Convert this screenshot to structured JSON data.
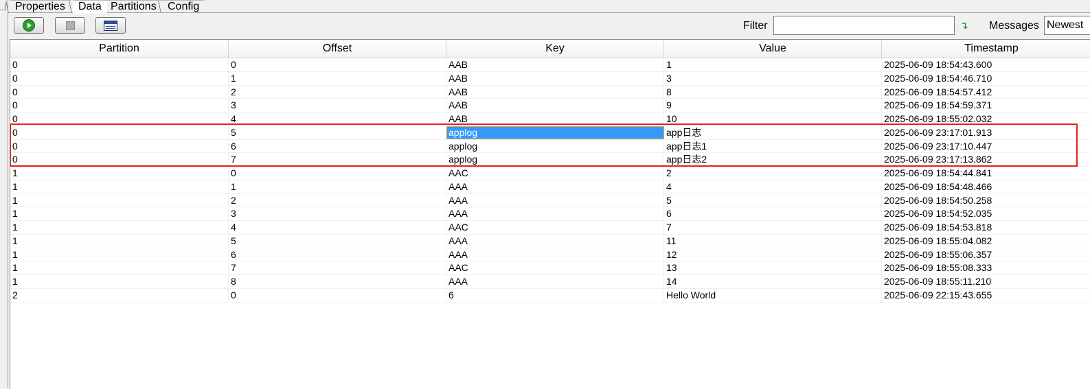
{
  "tabs": [
    {
      "label": "Properties"
    },
    {
      "label": "Data"
    },
    {
      "label": "Partitions"
    },
    {
      "label": "Config"
    }
  ],
  "toolbar": {
    "filter_label": "Filter",
    "filter_value": "",
    "messages_label": "Messages",
    "messages_selected": "Newest"
  },
  "table": {
    "columns": [
      "Partition",
      "Offset",
      "Key",
      "Value",
      "Timestamp"
    ],
    "rows": [
      [
        "0",
        "0",
        "AAB",
        "1",
        "2025-06-09 18:54:43.600"
      ],
      [
        "0",
        "1",
        "AAB",
        "3",
        "2025-06-09 18:54:46.710"
      ],
      [
        "0",
        "2",
        "AAB",
        "8",
        "2025-06-09 18:54:57.412"
      ],
      [
        "0",
        "3",
        "AAB",
        "9",
        "2025-06-09 18:54:59.371"
      ],
      [
        "0",
        "4",
        "AAB",
        "10",
        "2025-06-09 18:55:02.032"
      ],
      [
        "0",
        "5",
        "applog",
        "app日志",
        "2025-06-09 23:17:01.913"
      ],
      [
        "0",
        "6",
        "applog",
        "app日志1",
        "2025-06-09 23:17:10.447"
      ],
      [
        "0",
        "7",
        "applog",
        "app日志2",
        "2025-06-09 23:17:13.862"
      ],
      [
        "1",
        "0",
        "AAC",
        "2",
        "2025-06-09 18:54:44.841"
      ],
      [
        "1",
        "1",
        "AAA",
        "4",
        "2025-06-09 18:54:48.466"
      ],
      [
        "1",
        "2",
        "AAA",
        "5",
        "2025-06-09 18:54:50.258"
      ],
      [
        "1",
        "3",
        "AAA",
        "6",
        "2025-06-09 18:54:52.035"
      ],
      [
        "1",
        "4",
        "AAC",
        "7",
        "2025-06-09 18:54:53.818"
      ],
      [
        "1",
        "5",
        "AAA",
        "11",
        "2025-06-09 18:55:04.082"
      ],
      [
        "1",
        "6",
        "AAA",
        "12",
        "2025-06-09 18:55:06.357"
      ],
      [
        "1",
        "7",
        "AAC",
        "13",
        "2025-06-09 18:55:08.333"
      ],
      [
        "1",
        "8",
        "AAA",
        "14",
        "2025-06-09 18:55:11.210"
      ],
      [
        "2",
        "0",
        "6",
        "Hello World",
        "2025-06-09 22:15:43.655"
      ]
    ]
  },
  "colors": {
    "selection": "#3399ff",
    "highlight_border": "#e02020"
  }
}
